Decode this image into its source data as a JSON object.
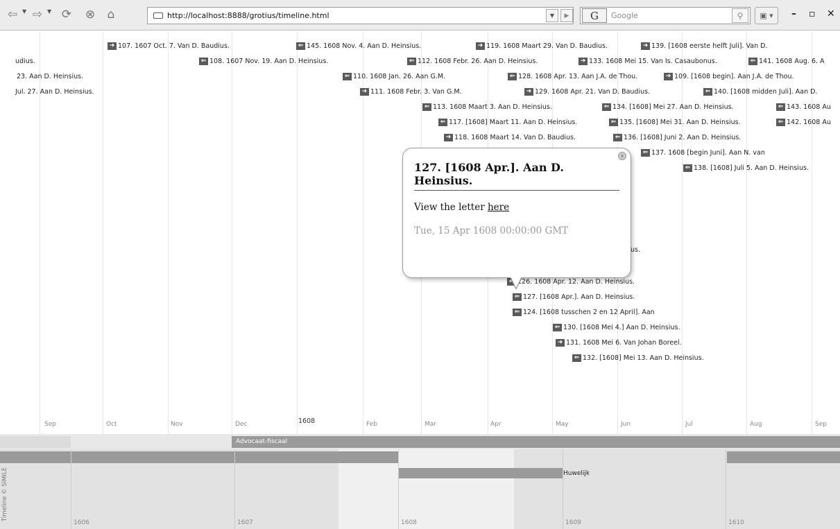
{
  "browser": {
    "url": "http://localhost:8888/grotius/timeline.html",
    "search_engine_icon": "google-g-icon",
    "search_placeholder": "Google"
  },
  "timeline": {
    "months": [
      "Sep",
      "Oct",
      "Nov",
      "Dec",
      "1608",
      "Feb",
      "Mar",
      "Apr",
      "May",
      "Jun",
      "Jul",
      "Aug",
      "Sep"
    ],
    "events": [
      {
        "dir": "from",
        "text": "107. 1607 Oct. 7. Van D. Baudius."
      },
      {
        "dir": "to",
        "text": "145. 1608 Nov. 4. Aan D. Heinsius."
      },
      {
        "dir": "from",
        "text": "119. 1608 Maart 29. Van D. Baudius."
      },
      {
        "dir": "from",
        "text": "139. [1608 eerste helft Juli]. Van D."
      },
      {
        "dir": "none",
        "text": "udius."
      },
      {
        "dir": "to",
        "text": "108. 1607 Nov. 19. Aan D. Heinsius."
      },
      {
        "dir": "to",
        "text": "112. 1608 Febr. 26. Aan D. Heinsius."
      },
      {
        "dir": "from",
        "text": "133. 1608 Mei 15. Van Is. Casaubonus."
      },
      {
        "dir": "to",
        "text": "141. 1608 Aug. 6. A"
      },
      {
        "dir": "none",
        "text": "23. Aan D. Heinsius."
      },
      {
        "dir": "to",
        "text": "110. 1608 Jan. 26. Aan G.M."
      },
      {
        "dir": "to",
        "text": "128. 1608 Apr. 13. Aan J.A. de Thou."
      },
      {
        "dir": "from",
        "text": "109. [1608 begin]. Aan J.A. de Thou."
      },
      {
        "dir": "none",
        "text": "Jul. 27. Aan D. Heinsius."
      },
      {
        "dir": "from",
        "text": "111. 1608 Febr. 3. Van G.M."
      },
      {
        "dir": "from",
        "text": "129. 1608 Apr. 21. Van D. Baudius."
      },
      {
        "dir": "to",
        "text": "140. [1608 midden Juli]. Aan D."
      },
      {
        "dir": "to",
        "text": "113. 1608 Maart 3. Aan D. Heinsius."
      },
      {
        "dir": "to",
        "text": "134. [1608] Mei 27. Aan D. Heinsius."
      },
      {
        "dir": "to",
        "text": "143. 1608 Au"
      },
      {
        "dir": "to",
        "text": "117. [1608] Maart 11. Aan D. Heinsius."
      },
      {
        "dir": "to",
        "text": "135. [1608] Mei 31. Aan D. Heinsius."
      },
      {
        "dir": "to",
        "text": "142. 1608 Au"
      },
      {
        "dir": "from",
        "text": "118. 1608 Maart 14. Van D. Baudius."
      },
      {
        "dir": "to",
        "text": "136. [1608] Juni 2. Aan D. Heinsius."
      },
      {
        "dir": "to",
        "text": "137. 1608 [begin Juni]. Aan N. van"
      },
      {
        "dir": "to",
        "text": "138. [1608] Juli 5. Aan D. Heinsius."
      },
      {
        "dir": "none",
        "text": "us."
      },
      {
        "dir": "to",
        "text": "126. 1608 Apr. 12. Aan D. Heinsius."
      },
      {
        "dir": "to",
        "text": "127. [1608 Apr.]. Aan D. Heinsius."
      },
      {
        "dir": "to",
        "text": "124. [1608 tusschen 2 en 12 April]. Aan"
      },
      {
        "dir": "to",
        "text": "130. [1608 Mei 4.] Aan D. Heinsius."
      },
      {
        "dir": "from",
        "text": "131. 1608 Mei 6. Van Johan Boreel."
      },
      {
        "dir": "to",
        "text": "132. [1608] Mei 13. Aan D. Heinsius."
      }
    ]
  },
  "bubble": {
    "title": "127. [1608 Apr.]. Aan D. Heinsius.",
    "view_prefix": "View the letter ",
    "view_link": "here",
    "date": "Tue, 15 Apr 1608 00:00:00 GMT"
  },
  "bands": {
    "advocaat_label": "Advocaat-fiscaal",
    "huwelijk_label": "Huwelijk",
    "years": [
      "1606",
      "1607",
      "1608",
      "1609",
      "1610"
    ],
    "credit": "Timeline © SIMILE"
  }
}
